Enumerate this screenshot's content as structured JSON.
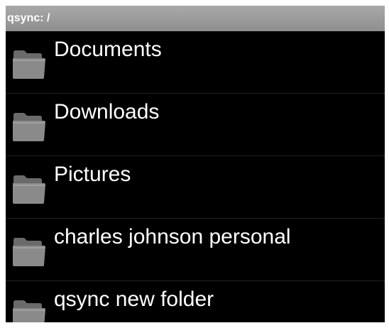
{
  "header": {
    "title": "qsync: /"
  },
  "folders": [
    {
      "name": "Documents",
      "icon": "folder-icon"
    },
    {
      "name": "Downloads",
      "icon": "folder-icon"
    },
    {
      "name": "Pictures",
      "icon": "folder-icon"
    },
    {
      "name": "charles johnson personal",
      "icon": "folder-icon"
    },
    {
      "name": "qsync new folder",
      "icon": "folder-icon"
    }
  ],
  "colors": {
    "background": "#000000",
    "titlebar": "#9a9a9a",
    "text": "#ffffff",
    "folder": "#7a7a7a"
  }
}
